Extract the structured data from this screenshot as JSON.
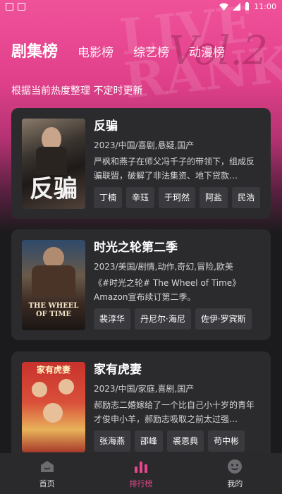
{
  "status_bar": {
    "time": "11:00"
  },
  "header": {
    "tabs": [
      {
        "label": "剧集榜",
        "active": true
      },
      {
        "label": "电影榜",
        "active": false
      },
      {
        "label": "综艺榜",
        "active": false
      },
      {
        "label": "动漫榜",
        "active": false
      }
    ],
    "subtitle": "根据当前热度整理 不定时更新"
  },
  "cards": [
    {
      "title": "反骗",
      "meta": "2023/中国/喜剧,悬疑,国产",
      "desc": "严枫和燕子在师父冯千子的带领下，组成反骗联盟，破解了非法集资、地下贷款…",
      "tags": [
        "丁楠",
        "辛珏",
        "于珂然",
        "阿盐",
        "民浩"
      ],
      "poster_text": "反骗"
    },
    {
      "title": "时光之轮第二季",
      "meta": "2023/美国/剧情,动作,奇幻,冒险,欧美",
      "desc": "《#时光之轮# The Wheel of Time》Amazon宣布续订第二季。",
      "tags": [
        "裴淳华",
        "丹尼尔·海尼",
        "佐伊·罗宾斯"
      ],
      "poster_text": "THE WHEEL OF TIME"
    },
    {
      "title": "家有虎妻",
      "meta": "2023/中国/家庭,喜剧,国产",
      "desc": "郝励志二婚嫁给了一个比自己小十岁的青年才俊申小羊，郝励志吸取之前太过强…",
      "tags": [
        "张海燕",
        "邵峰",
        "裘恩典",
        "苟中彬"
      ],
      "poster_text": "家有虎妻"
    }
  ],
  "bottom_nav": [
    {
      "label": "首页",
      "active": false
    },
    {
      "label": "排行榜",
      "active": true
    },
    {
      "label": "我的",
      "active": false
    }
  ],
  "colors": {
    "accent": "#e8468f",
    "card_bg": "#2b2b2e",
    "page_bg": "#1b1b1d"
  }
}
